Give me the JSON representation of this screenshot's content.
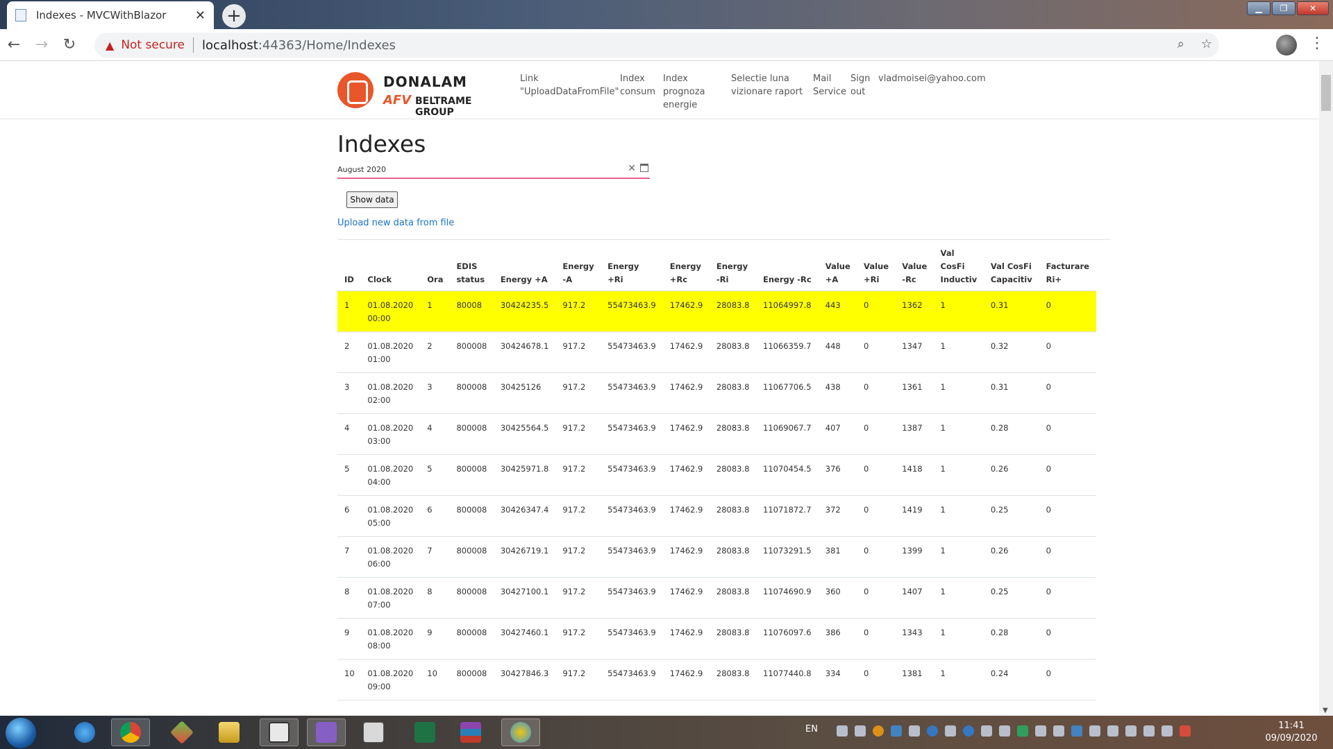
{
  "browser": {
    "tab_title": "Indexes - MVCWithBlazor",
    "tab_close": "✕",
    "new_tab": "+",
    "security_label": "Not secure",
    "url_host": "localhost",
    "url_rest": ":44363/Home/Indexes",
    "window_buttons": [
      "▁",
      "❐",
      "✕"
    ]
  },
  "header": {
    "brand": "DONALAM",
    "brand_sub_afv": "AFV",
    "brand_sub_group": "BELTRAME GROUP",
    "nav": {
      "link": [
        "Link",
        "\"UploadDataFromFile\""
      ],
      "index_consum": [
        "Index",
        "consum"
      ],
      "index_prognoza": [
        "Index",
        "prognoza",
        "energie"
      ],
      "selectie": [
        "Selectie luna",
        "vizionare raport"
      ],
      "mail": [
        "Mail",
        "Service"
      ],
      "signout": [
        "Sign",
        "out"
      ],
      "user": "vladmoisei@yahoo.com"
    }
  },
  "page": {
    "title": "Indexes",
    "month_value": "August 2020",
    "show_button": "Show data",
    "upload_link": "Upload new data from file"
  },
  "table": {
    "headers": [
      [
        "ID"
      ],
      [
        "Clock"
      ],
      [
        "Ora"
      ],
      [
        "EDIS",
        "status"
      ],
      [
        "Energy +A"
      ],
      [
        "Energy",
        "-A"
      ],
      [
        "Energy",
        "+Ri"
      ],
      [
        "Energy",
        "+Rc"
      ],
      [
        "Energy",
        "-Ri"
      ],
      [
        "Energy -Rc"
      ],
      [
        "Value",
        "+A"
      ],
      [
        "Value",
        "+Ri"
      ],
      [
        "Value",
        "-Rc"
      ],
      [
        "Val",
        "CosFi",
        "Inductiv"
      ],
      [
        "Val CosFi",
        "Capacitiv"
      ],
      [
        "Facturare",
        "Ri+"
      ]
    ],
    "rows": [
      [
        "1",
        [
          "01.08.2020",
          "00:00"
        ],
        "1",
        "80008",
        "30424235.5",
        "917.2",
        "55473463.9",
        "17462.9",
        "28083.8",
        "11064997.8",
        "443",
        "0",
        "1362",
        "1",
        "0.31",
        "0"
      ],
      [
        "2",
        [
          "01.08.2020",
          "01:00"
        ],
        "2",
        "800008",
        "30424678.1",
        "917.2",
        "55473463.9",
        "17462.9",
        "28083.8",
        "11066359.7",
        "448",
        "0",
        "1347",
        "1",
        "0.32",
        "0"
      ],
      [
        "3",
        [
          "01.08.2020",
          "02:00"
        ],
        "3",
        "800008",
        "30425126",
        "917.2",
        "55473463.9",
        "17462.9",
        "28083.8",
        "11067706.5",
        "438",
        "0",
        "1361",
        "1",
        "0.31",
        "0"
      ],
      [
        "4",
        [
          "01.08.2020",
          "03:00"
        ],
        "4",
        "800008",
        "30425564.5",
        "917.2",
        "55473463.9",
        "17462.9",
        "28083.8",
        "11069067.7",
        "407",
        "0",
        "1387",
        "1",
        "0.28",
        "0"
      ],
      [
        "5",
        [
          "01.08.2020",
          "04:00"
        ],
        "5",
        "800008",
        "30425971.8",
        "917.2",
        "55473463.9",
        "17462.9",
        "28083.8",
        "11070454.5",
        "376",
        "0",
        "1418",
        "1",
        "0.26",
        "0"
      ],
      [
        "6",
        [
          "01.08.2020",
          "05:00"
        ],
        "6",
        "800008",
        "30426347.4",
        "917.2",
        "55473463.9",
        "17462.9",
        "28083.8",
        "11071872.7",
        "372",
        "0",
        "1419",
        "1",
        "0.25",
        "0"
      ],
      [
        "7",
        [
          "01.08.2020",
          "06:00"
        ],
        "7",
        "800008",
        "30426719.1",
        "917.2",
        "55473463.9",
        "17462.9",
        "28083.8",
        "11073291.5",
        "381",
        "0",
        "1399",
        "1",
        "0.26",
        "0"
      ],
      [
        "8",
        [
          "01.08.2020",
          "07:00"
        ],
        "8",
        "800008",
        "30427100.1",
        "917.2",
        "55473463.9",
        "17462.9",
        "28083.8",
        "11074690.9",
        "360",
        "0",
        "1407",
        "1",
        "0.25",
        "0"
      ],
      [
        "9",
        [
          "01.08.2020",
          "08:00"
        ],
        "9",
        "800008",
        "30427460.1",
        "917.2",
        "55473463.9",
        "17462.9",
        "28083.8",
        "11076097.6",
        "386",
        "0",
        "1343",
        "1",
        "0.28",
        "0"
      ],
      [
        "10",
        [
          "01.08.2020",
          "09:00"
        ],
        "10",
        "800008",
        "30427846.3",
        "917.2",
        "55473463.9",
        "17462.9",
        "28083.8",
        "11077440.8",
        "334",
        "0",
        "1381",
        "1",
        "0.24",
        "0"
      ]
    ],
    "highlight_color": "#ffff00"
  },
  "taskbar": {
    "language": "EN",
    "time": "11:41",
    "date": "09/09/2020"
  }
}
